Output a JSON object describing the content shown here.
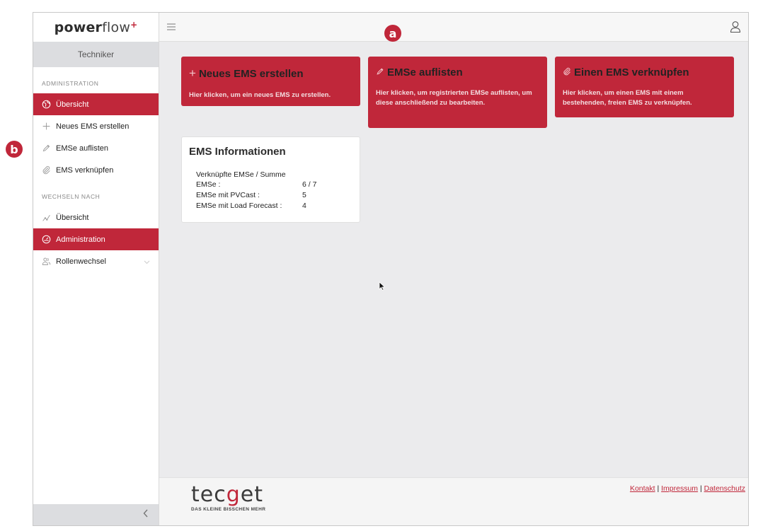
{
  "app": {
    "logo_bold": "power",
    "logo_thin": "flow",
    "logo_plus": "+"
  },
  "sidebar": {
    "role": "Techniker",
    "section_admin": "ADMINISTRATION",
    "admin_items": [
      {
        "label": "Übersicht",
        "icon": "globe-icon",
        "active": true
      },
      {
        "label": "Neues EMS erstellen",
        "icon": "plus-icon",
        "active": false
      },
      {
        "label": "EMSe auflisten",
        "icon": "pencil-icon",
        "active": false
      },
      {
        "label": "EMS verknüpfen",
        "icon": "paperclip-icon",
        "active": false
      }
    ],
    "section_switch": "WECHSELN NACH",
    "switch_items": [
      {
        "label": "Übersicht",
        "icon": "chart-line-icon",
        "active": false
      },
      {
        "label": "Administration",
        "icon": "dashboard-icon",
        "active": true
      },
      {
        "label": "Rollenwechsel",
        "icon": "users-icon",
        "active": false
      }
    ]
  },
  "cards": {
    "new": {
      "title": "Neues EMS erstellen",
      "desc": "Hier klicken, um ein neues EMS zu erstellen."
    },
    "list": {
      "title": "EMSe auflisten",
      "desc": "Hier klicken, um registrierten EMSe auflisten, um diese anschließend zu bearbeiten."
    },
    "link": {
      "title": "Einen EMS verknüpfen",
      "desc": "Hier klicken, um einen EMS mit einem bestehenden, freien EMS zu verknüpfen."
    }
  },
  "info": {
    "title": "EMS Informationen",
    "subtitle": "Verknüpfte EMSe / Summe",
    "rows": [
      {
        "label": "EMSe :",
        "value": "6 / 7"
      },
      {
        "label": "EMSe mit PVCast :",
        "value": "5"
      },
      {
        "label": "EMSe mit Load Forecast :",
        "value": "4"
      }
    ]
  },
  "footer": {
    "brand_pre": "tec",
    "brand_g": "g",
    "brand_post": "et",
    "tagline": "DAS KLEINE BISSCHEN MEHR",
    "link_contact": "Kontakt",
    "link_imprint": "Impressum",
    "link_privacy": "Datenschutz",
    "separator": " | "
  },
  "markers": {
    "a": "a",
    "b": "b"
  },
  "colors": {
    "accent": "#c0273a",
    "background": "#ebebed",
    "sidebar_role_bg": "#dcdde0"
  }
}
